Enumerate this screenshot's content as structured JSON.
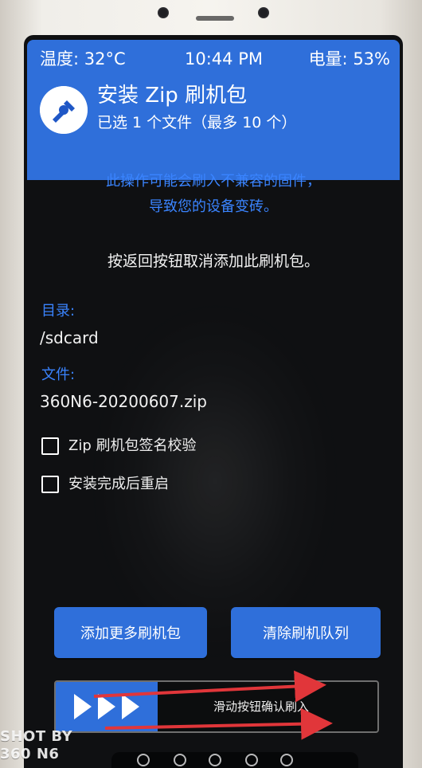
{
  "status_bar": {
    "temperature": "温度: 32°C",
    "time": "10:44 PM",
    "battery": "电量: 53%"
  },
  "header": {
    "title": "安装 Zip 刷机包",
    "subtitle": "已选 1 个文件（最多 10 个）"
  },
  "warning": {
    "line1": "此操作可能会刷入不兼容的固件，",
    "line2": "导致您的设备变砖。"
  },
  "instruction": "按返回按钮取消添加此刷机包。",
  "directory": {
    "label": "目录:",
    "value": "/sdcard"
  },
  "file": {
    "label": "文件:",
    "value": "360N6-20200607.zip"
  },
  "options": [
    {
      "label": "Zip 刷机包签名校验",
      "checked": false
    },
    {
      "label": "安装完成后重启",
      "checked": false
    }
  ],
  "buttons": {
    "add_more": "添加更多刷机包",
    "clear_queue": "清除刷机队列"
  },
  "swipe": {
    "label": "滑动按钮确认刷入"
  },
  "watermark": {
    "line1": "SHOT BY",
    "line2": "360 N6"
  },
  "colors": {
    "accent_blue": "#2F6FDA",
    "warning_blue": "#3A84FF",
    "annotation_red": "#E1363A"
  },
  "icons": {
    "logo": "twrp-logo-icon",
    "swipe_arrows": "triple-play-arrow-icon",
    "checkbox": "checkbox-icon"
  }
}
